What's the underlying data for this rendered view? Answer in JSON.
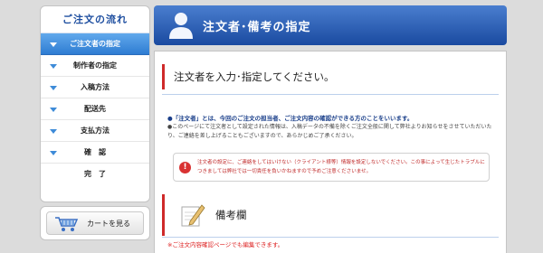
{
  "sidebar": {
    "title": "ご注文の流れ",
    "steps": [
      {
        "label": "ご注文者の指定",
        "arrow": true,
        "active": true
      },
      {
        "label": "制作者の指定",
        "arrow": true
      },
      {
        "label": "入稿方法",
        "arrow": true
      },
      {
        "label": "配送先",
        "arrow": true
      },
      {
        "label": "支払方法",
        "arrow": true
      },
      {
        "label": "確　認",
        "arrow": true
      },
      {
        "label": "完　了",
        "arrow": false
      }
    ]
  },
  "cart": {
    "label": "カートを見る",
    "icon": "cart-icon"
  },
  "header": {
    "title": "注文者･備考の指定",
    "icon": "person-icon"
  },
  "main": {
    "section_title": "注文者を入力･指定してください。",
    "note1": "●「注文者」とは、今回のご注文の担当者、ご注文内容の確認ができる方のことをいいます。",
    "note2": "●このページにて注文者として設定された情報は、入稿データの不備を除くご注文全般に関して弊社よりお知らせをさせていただいたり、ご連絡を差し上げることもございますので、あらかじめご了承ください。",
    "alert": "注文者の設定に、ご連絡をしてはいけない（クライアント様等）情報を設定しないでください。この事によって生じたトラブルにつきましては弊社では一切責任を負いかねますので予めご注意くださいませ。",
    "remarks_title": "備考欄",
    "remarks_note": "※ご注文内容確認ページでも編集できます。"
  },
  "colors": {
    "accent_blue": "#2e7cd2",
    "header_blue": "#1a4aa0",
    "alert_red": "#d93232"
  }
}
